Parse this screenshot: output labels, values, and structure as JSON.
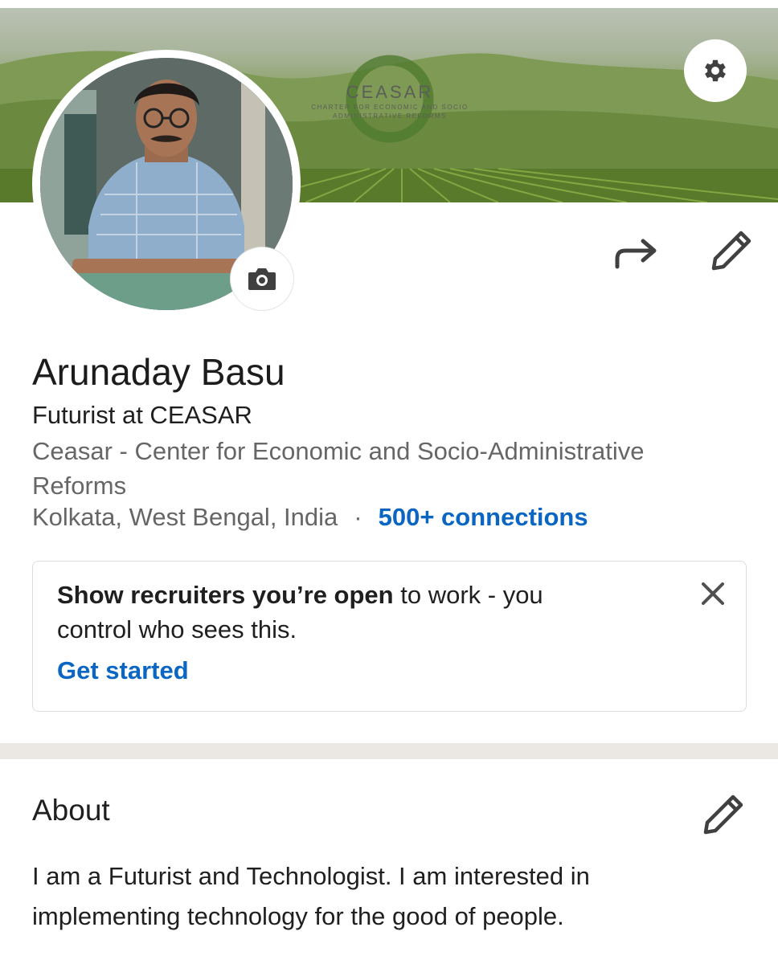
{
  "banner": {
    "logo_title": "CEASAR",
    "logo_subtitle_line1": "CHARTER FOR ECONOMIC AND SOCIO",
    "logo_subtitle_line2": "ADMINISTRATIVE REFORMS"
  },
  "icons": {
    "settings": "gear-icon",
    "camera": "camera-icon",
    "share": "share-arrow-icon",
    "edit": "pencil-icon",
    "close": "close-icon"
  },
  "profile": {
    "name": "Arunaday Basu",
    "headline": "Futurist at CEASAR",
    "company": "Ceasar - Center for Economic and Socio-Administrative Reforms",
    "location": "Kolkata, West Bengal, India",
    "separator": "·",
    "connections": "500+ connections"
  },
  "open_to_work_card": {
    "text_bold": "Show recruiters you’re open",
    "text_rest": " to work - you control who sees this.",
    "link": "Get started"
  },
  "about": {
    "title": "About",
    "text": "I am a Futurist and Technologist. I am interested in implementing technology for the good of people."
  },
  "colors": {
    "accent": "#0a66c2",
    "secondary_text": "#666666",
    "divider": "#ebe8e3"
  }
}
